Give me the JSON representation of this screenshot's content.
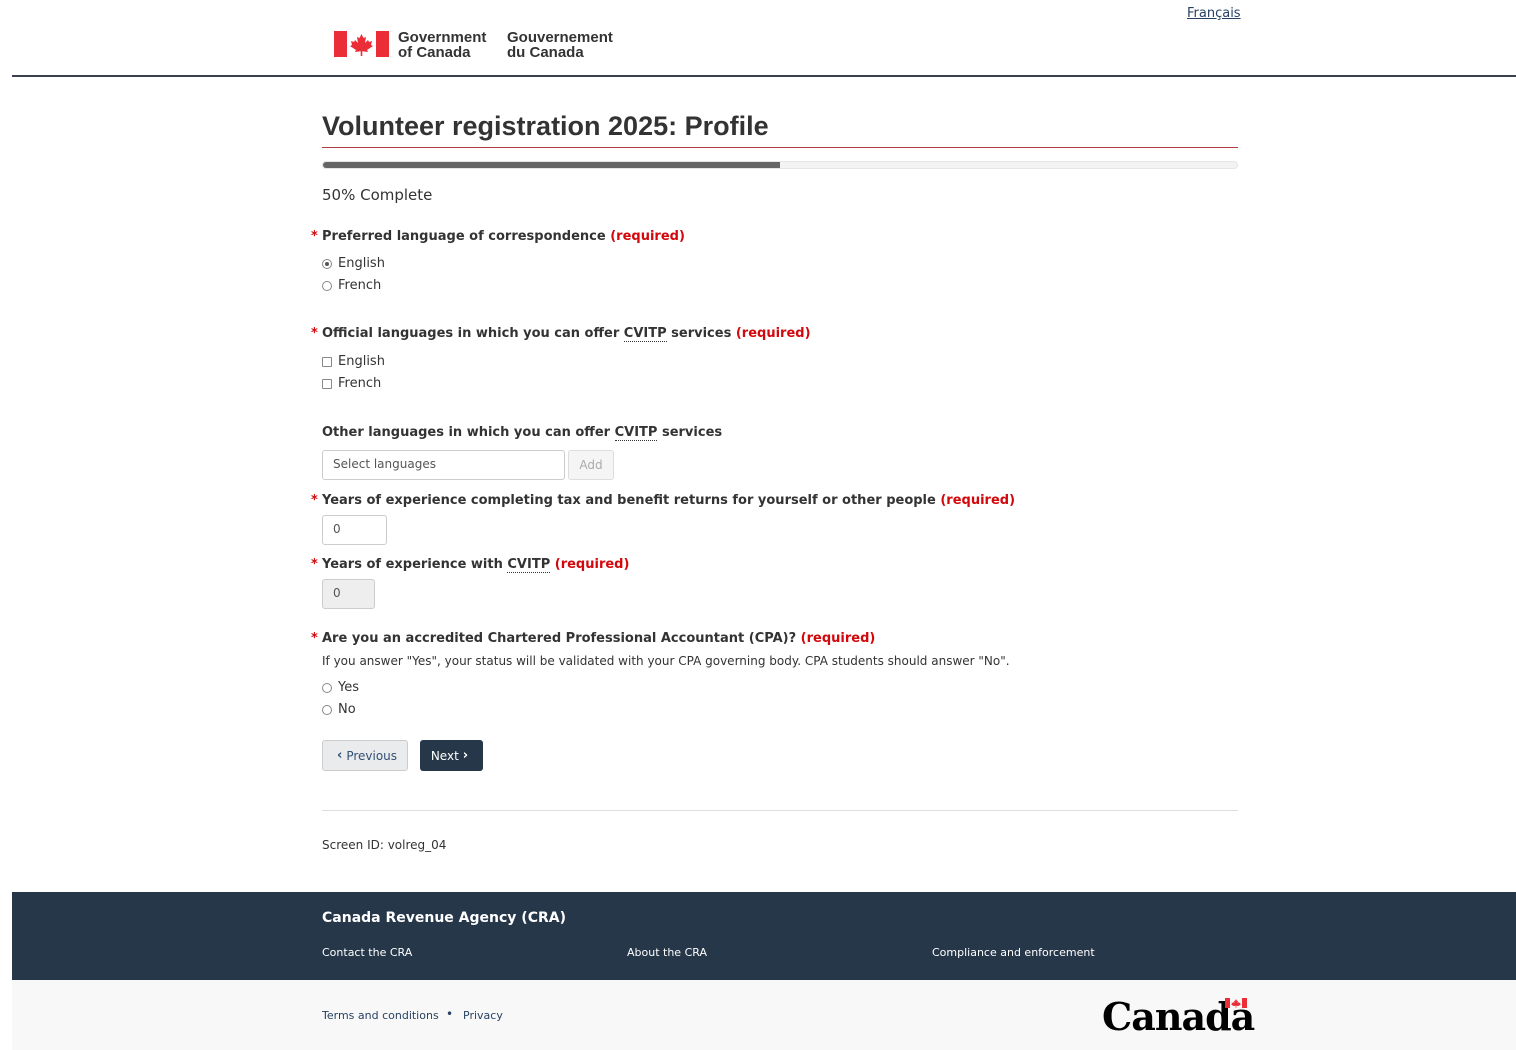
{
  "header": {
    "lang_toggle": "Français",
    "signature_en_line1": "Government",
    "signature_en_line2": "of Canada",
    "signature_fr_line1": "Gouvernement",
    "signature_fr_line2": "du Canada"
  },
  "page": {
    "title": "Volunteer registration 2025: Profile",
    "progress_text": "50% Complete",
    "progress_fraction": 0.5
  },
  "form": {
    "q1": {
      "star": "*",
      "label": "Preferred language of correspondence",
      "required": "(required)",
      "options": [
        "English",
        "French"
      ],
      "selected": "English"
    },
    "q2": {
      "star": "*",
      "label_pre": "Official languages in which you can offer",
      "abbr": "CVITP",
      "label_post": "services",
      "required": "(required)",
      "options": [
        "English",
        "French"
      ]
    },
    "q3": {
      "label_pre": "Other languages in which you can offer",
      "abbr": "CVITP",
      "label_post": "services",
      "placeholder": "Select languages",
      "add_label": "Add"
    },
    "q4": {
      "star": "*",
      "label": "Years of experience completing tax and benefit returns for yourself or other people",
      "required": "(required)",
      "value": "0"
    },
    "q5": {
      "star": "*",
      "label_pre": "Years of experience with",
      "abbr": "CVITP",
      "required": "(required)",
      "value": "0"
    },
    "q6": {
      "star": "*",
      "label": "Are you an accredited Chartered Professional Accountant (CPA)?",
      "required": "(required)",
      "help": "If you answer \"Yes\", your status will be validated with your CPA governing body. CPA students should answer \"No\".",
      "options": [
        "Yes",
        "No"
      ]
    },
    "previous_label": "Previous",
    "next_label": "Next",
    "screen_id": "Screen ID: volreg_04"
  },
  "footer": {
    "title": "Canada Revenue Agency (CRA)",
    "links": [
      "Contact the CRA",
      "About the CRA",
      "Compliance and enforcement"
    ],
    "sub_links": [
      "Terms and conditions",
      "Privacy"
    ],
    "bullet": "•",
    "wordmark": "Canada"
  },
  "colors": {
    "required_red": "#d3080c",
    "footer_bg": "#26374a",
    "next_button": "#26374a",
    "flag_red": "#eb2d37"
  }
}
